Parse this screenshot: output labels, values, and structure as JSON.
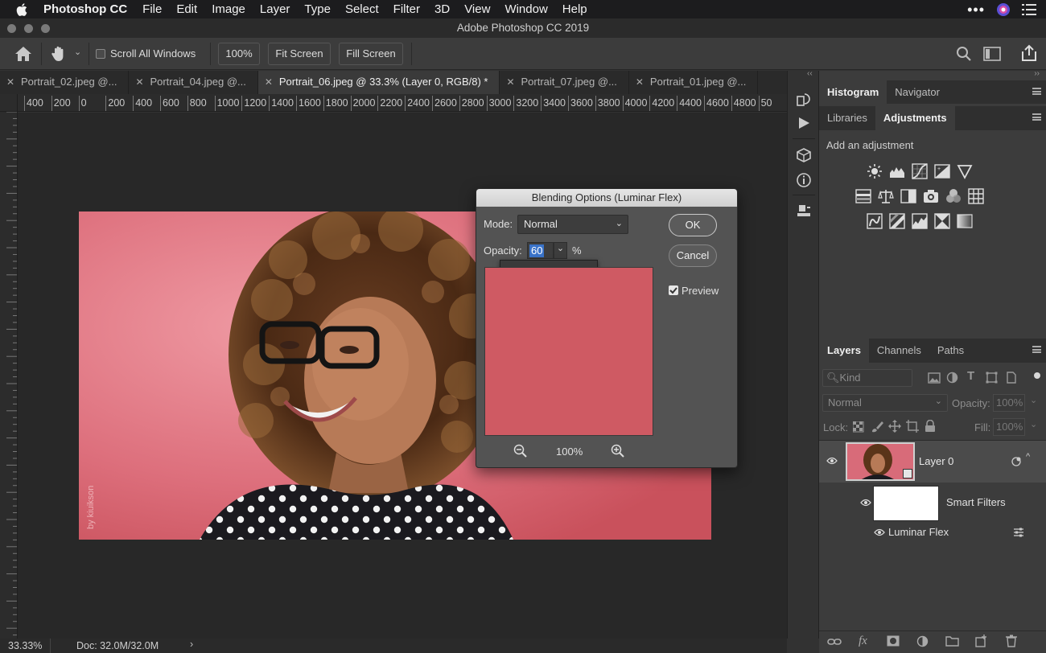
{
  "menubar": {
    "app_name": "Photoshop CC",
    "items": [
      "File",
      "Edit",
      "Image",
      "Layer",
      "Type",
      "Select",
      "Filter",
      "3D",
      "View",
      "Window",
      "Help"
    ]
  },
  "window": {
    "title": "Adobe Photoshop CC 2019"
  },
  "options_bar": {
    "scroll_all_windows_label": "Scroll All Windows",
    "scroll_all_windows_checked": false,
    "zoom_button": "100%",
    "fit_screen_button": "Fit Screen",
    "fill_screen_button": "Fill Screen"
  },
  "tabs": [
    {
      "label": "Portrait_02.jpeg @...",
      "active": false
    },
    {
      "label": "Portrait_04.jpeg @...",
      "active": false
    },
    {
      "label": "Portrait_06.jpeg @ 33.3% (Layer 0, RGB/8) *",
      "active": true
    },
    {
      "label": "Portrait_07.jpeg @...",
      "active": false
    },
    {
      "label": "Portrait_01.jpeg @...",
      "active": false
    }
  ],
  "ruler_top_labels": [
    "400",
    "200",
    "0",
    "200",
    "400",
    "600",
    "800",
    "1000",
    "1200",
    "1400",
    "1600",
    "1800",
    "2000",
    "2200",
    "2400",
    "2600",
    "2800",
    "3000",
    "3200",
    "3400",
    "3600",
    "3800",
    "4000",
    "4200",
    "4400",
    "4600",
    "4800",
    "50"
  ],
  "canvas": {
    "watermark": "by kiuikson"
  },
  "dialog": {
    "title": "Blending Options (Luminar Flex)",
    "mode_label": "Mode:",
    "mode_value": "Normal",
    "opacity_label": "Opacity:",
    "opacity_value": "60",
    "opacity_unit": "%",
    "opacity_slider_fraction": 0.6,
    "ok_label": "OK",
    "cancel_label": "Cancel",
    "preview_label": "Preview",
    "preview_checked": true,
    "preview_zoom": "100%",
    "preview_color": "#cf5a63"
  },
  "panels": {
    "top_tabs": [
      "Histogram",
      "Navigator"
    ],
    "top_active": "Histogram",
    "mid_tabs": [
      "Libraries",
      "Adjustments"
    ],
    "mid_active": "Adjustments",
    "adjustments_title": "Add an adjustment",
    "adjustment_icons": [
      [
        "brightness-contrast-icon",
        "levels-icon",
        "curves-icon",
        "exposure-icon",
        "vibrance-icon"
      ],
      [
        "hue-saturation-icon",
        "color-balance-icon",
        "black-white-icon",
        "photo-filter-icon",
        "channel-mixer-icon",
        "color-lookup-icon"
      ],
      [
        "invert-icon",
        "posterize-icon",
        "threshold-icon",
        "selective-color-icon",
        "gradient-map-icon"
      ]
    ],
    "layers_tabs": [
      "Layers",
      "Channels",
      "Paths"
    ],
    "layers_active": "Layers",
    "kind_placeholder": "Kind",
    "blend_mode": "Normal",
    "opacity_label": "Opacity:",
    "opacity_value": "100%",
    "lock_label": "Lock:",
    "fill_label": "Fill:",
    "fill_value": "100%",
    "layers": [
      {
        "name": "Layer 0"
      },
      {
        "name": "Smart Filters"
      },
      {
        "name": "Luminar Flex"
      }
    ]
  },
  "status": {
    "zoom": "33.33%",
    "doc": "Doc: 32.0M/32.0M"
  },
  "colors": {
    "accent_blue": "#3a73c9",
    "photo_background": "#d86b79"
  }
}
